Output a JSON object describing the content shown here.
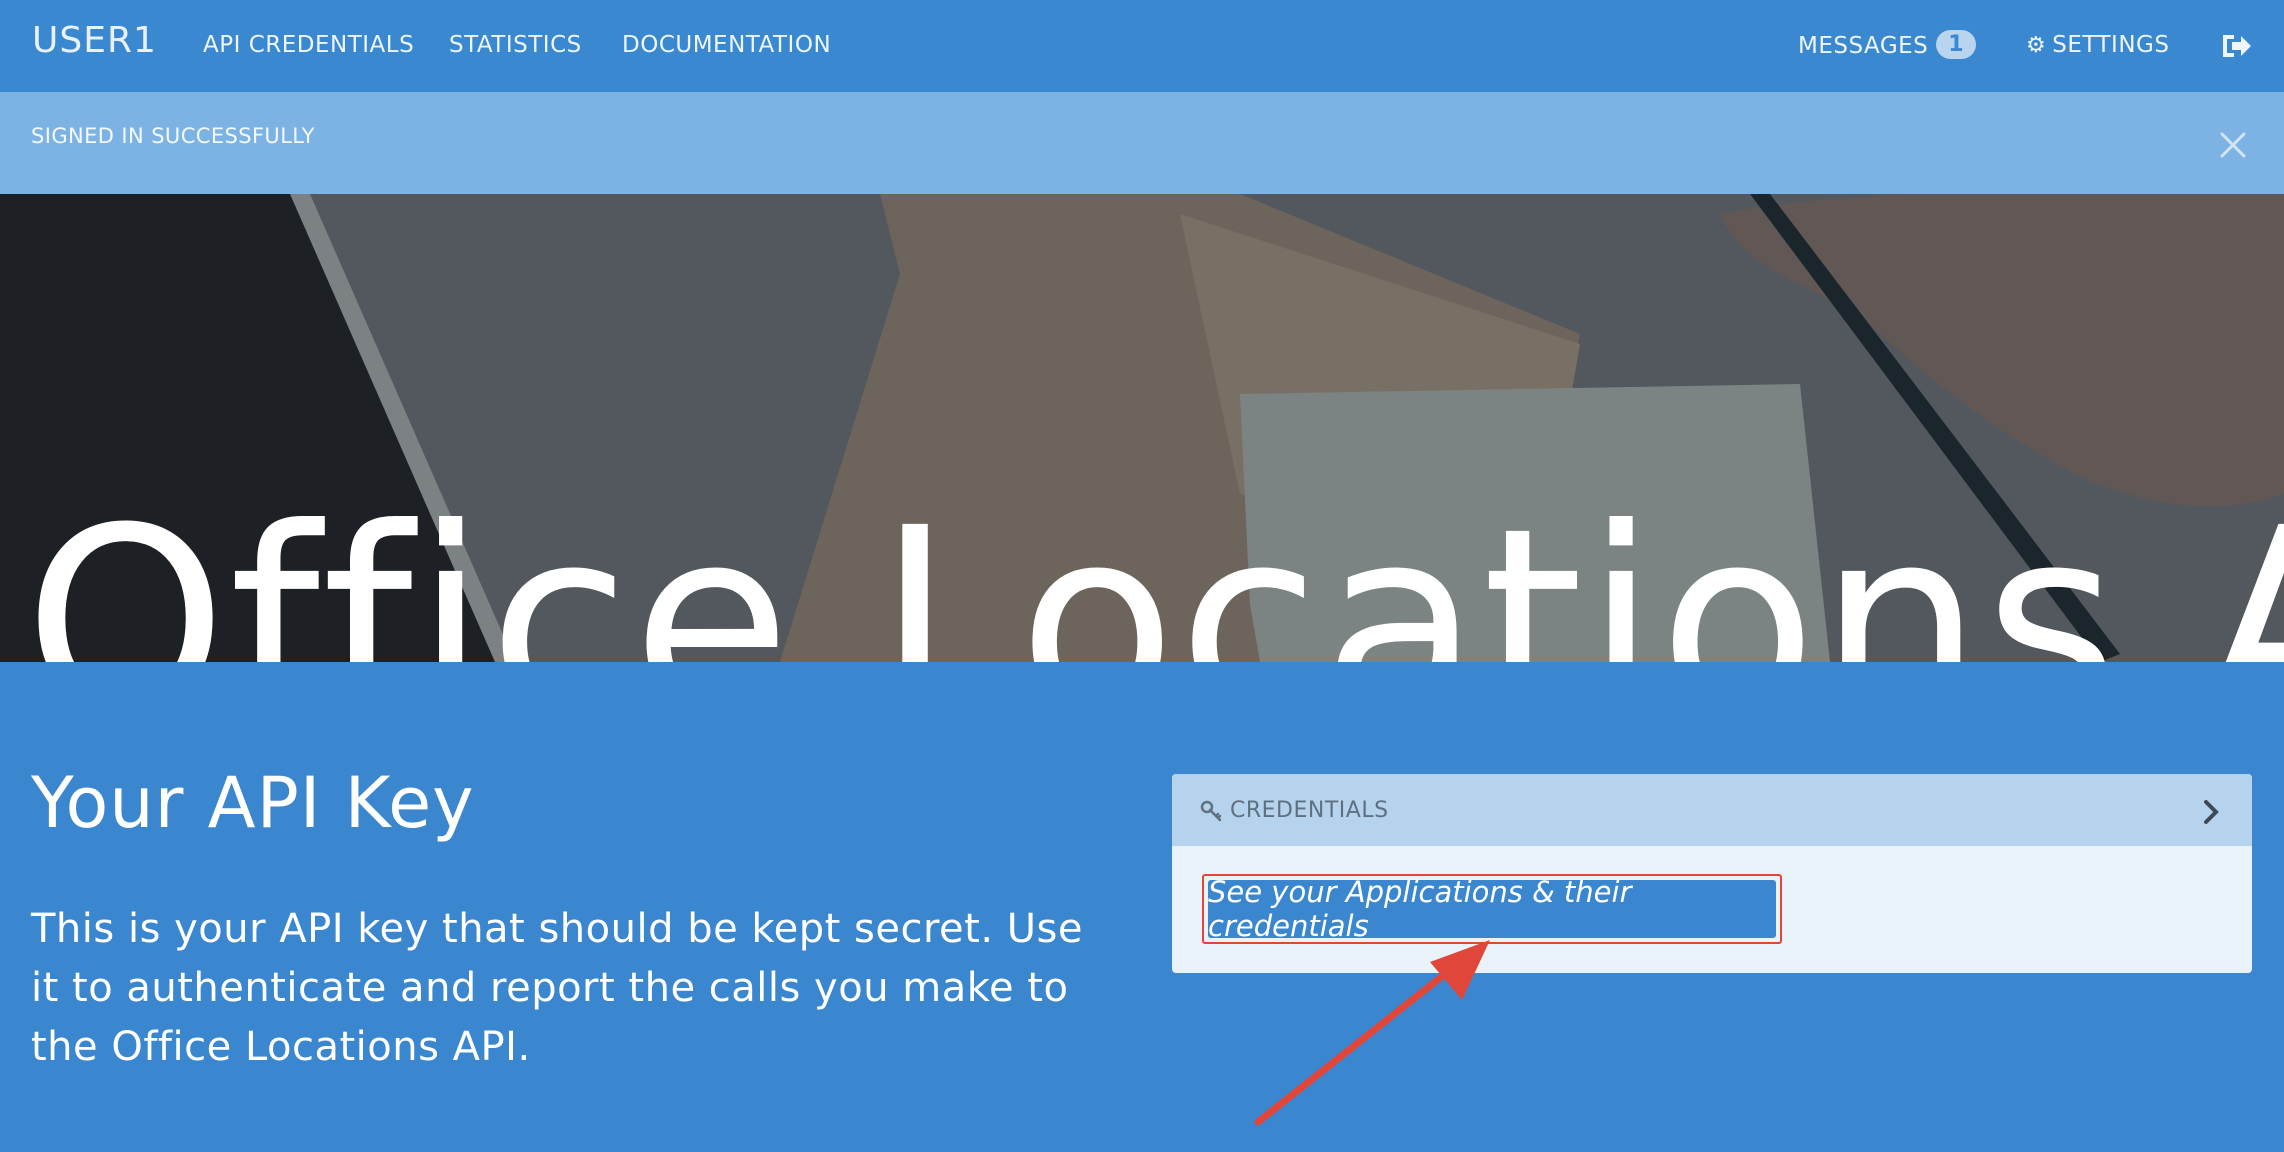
{
  "nav": {
    "brand": "USER1",
    "links": {
      "api_credentials": "API CREDENTIALS",
      "statistics": "STATISTICS",
      "documentation": "DOCUMENTATION"
    },
    "messages_label": "MESSAGES",
    "messages_count": "1",
    "settings_label": "SETTINGS",
    "logout_icon": "sign-out-icon"
  },
  "flash": {
    "message": "SIGNED IN SUCCESSFULLY",
    "close_icon": "close-icon"
  },
  "hero": {
    "title": "Office Locations API"
  },
  "main": {
    "heading": "Your API Key",
    "description": "This is your API key that should be kept secret. Use it to authenticate and report the calls you make to the Office Locations API."
  },
  "credentials_card": {
    "title": "CREDENTIALS",
    "icon": "key-icon",
    "button_label": "See your Applications & their credentials"
  },
  "colors": {
    "primary": "#3b87cf",
    "flash_bg": "#7db3e4",
    "card_header": "#b6d3ee",
    "card_body": "#e9f1f9",
    "highlight": "#e0473a"
  }
}
